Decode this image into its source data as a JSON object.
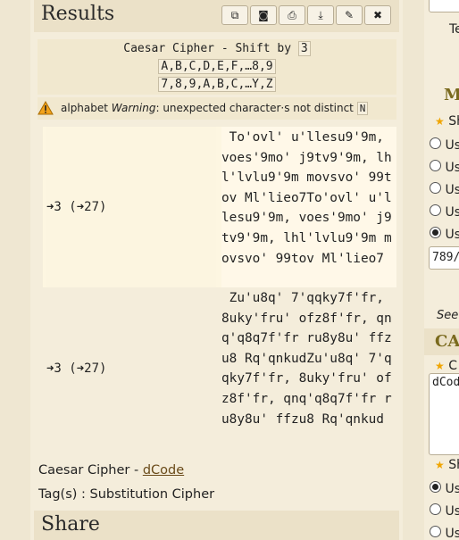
{
  "results": {
    "title": "Results",
    "toolbar": [
      {
        "name": "copy-button",
        "icon": "copy-icon",
        "glyph": "⧉"
      },
      {
        "name": "screenshot-button",
        "icon": "camera-icon",
        "glyph": "◙"
      },
      {
        "name": "print-button",
        "icon": "print-icon",
        "glyph": "⎙"
      },
      {
        "name": "download-button",
        "icon": "download-icon",
        "glyph": "⤓"
      },
      {
        "name": "pin-button",
        "icon": "pin-icon",
        "glyph": "✎"
      },
      {
        "name": "close-button",
        "icon": "close-icon",
        "glyph": "✖"
      }
    ],
    "cipher_title": "Caesar Cipher - Shift by",
    "shift": "3",
    "plain_alphabet": "A,B,C,D,E,F,…8,9",
    "cipher_alphabet": "7,8,9,A,B,C,…Y,Z",
    "warning_prefix": "alphabet",
    "warning_word": "Warning",
    "warning_text": ": unexpected character·s not distinct",
    "warning_box": "N",
    "rows": [
      {
        "key": "➜3 (➜27)",
        "value": " To'ovl' u'llesu9'9m, voes'9mo' j9tv9'9m, lhl'lvlu9'9m movsvo' 99tov Ml'lieo7To'ovl' u'llesu9'9m, voes'9mo' j9tv9'9m, lhl'lvlu9'9m movsvo' 99tov Ml'lieo7"
      },
      {
        "key": "➜3 (➜27)",
        "value": " Zu'u8q' 7'qqky7f'fr, 8uky'fru' ofz8f'fr, qnq'q8q7f'fr ru8y8u' ffzu8 Rq'qnkudZu'u8q' 7'qqky7f'fr, 8uky'fru' ofz8f'fr, qnq'q8q7f'fr ru8y8u' ffzu8 Rq'qnkud"
      }
    ],
    "source_prefix": "Caesar Cipher - ",
    "source_link": "dCode",
    "tags_label": "Tag(s) : Substitution Cipher"
  },
  "share": {
    "title": "Share"
  },
  "right_panel": {
    "top_text": "Te",
    "heading1": "M",
    "item1": "Sh",
    "options": [
      "Us",
      "Us",
      "Us",
      "Us",
      "Us"
    ],
    "input_value": "789/",
    "see_text": "See",
    "heading2": "CA",
    "item2": "C",
    "textarea_value": "dCod",
    "item3": "Sh",
    "options2": [
      "Us",
      "Us",
      "Us"
    ]
  },
  "colors": {
    "background": "#efe7d2",
    "header": "#ebe1c8",
    "link": "#6a4b1a",
    "star": "#f0a500"
  }
}
